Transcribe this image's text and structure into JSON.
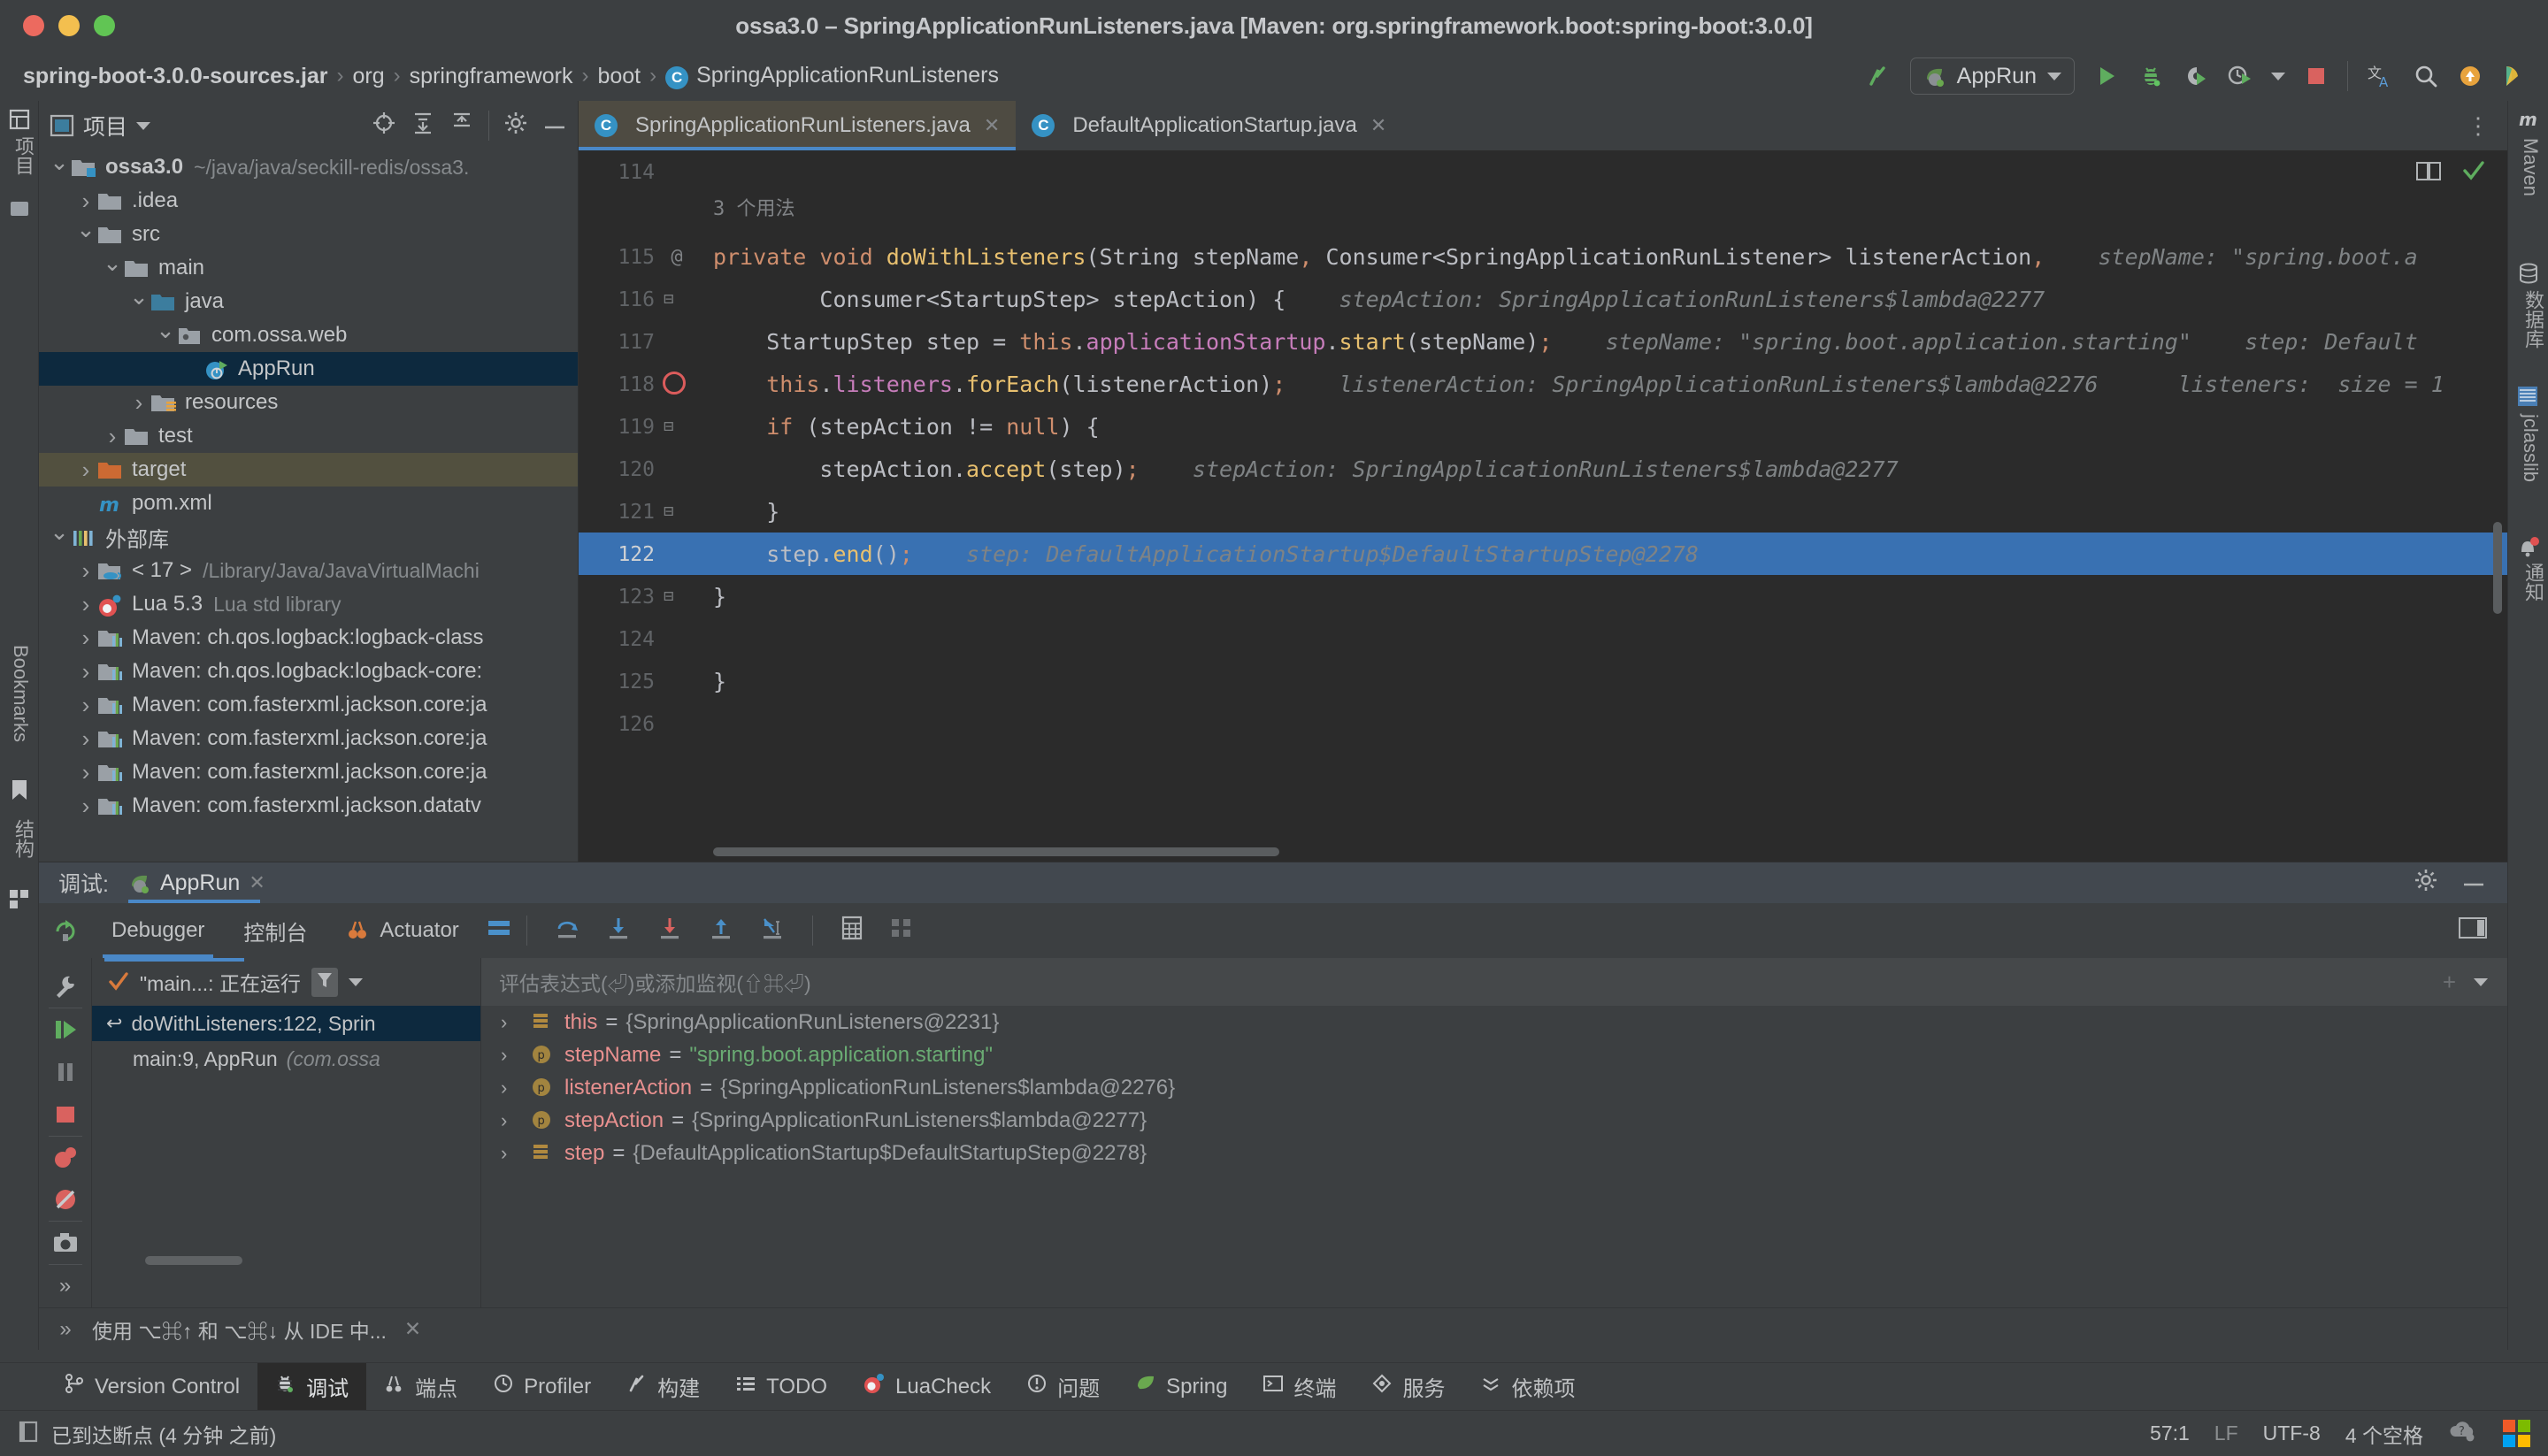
{
  "window": {
    "title": "ossa3.0 – SpringApplicationRunListeners.java [Maven: org.springframework.boot:spring-boot:3.0.0]",
    "traffic": [
      "close-button",
      "minimize-button",
      "maximize-button"
    ]
  },
  "breadcrumb": {
    "items": [
      {
        "label": "spring-boot-3.0.0-sources.jar",
        "kind": "jar"
      },
      {
        "label": "org",
        "kind": "package"
      },
      {
        "label": "springframework",
        "kind": "package"
      },
      {
        "label": "boot",
        "kind": "package"
      },
      {
        "label": "SpringApplicationRunListeners",
        "kind": "class",
        "badge": "C"
      }
    ],
    "separator": "›"
  },
  "nav_right": {
    "run_config": "AppRun",
    "actions": [
      "build-icon",
      "run-button",
      "debug-button",
      "run-with-coverage-button",
      "profiler-button",
      "stop-button",
      "translate-icon",
      "search-everywhere-icon",
      "update-icon",
      "ai-assistant-icon"
    ]
  },
  "project_panel": {
    "title": "项目",
    "header_actions": [
      "select-opened-file-icon",
      "expand-all-icon",
      "collapse-all-icon",
      "settings-gear-icon",
      "hide-icon"
    ],
    "tree": [
      {
        "indent": 0,
        "chev": "open",
        "icon": "module-folder",
        "label": "ossa3.0",
        "sub": "~/java/java/seckill-redis/ossa3.",
        "bold": true
      },
      {
        "indent": 1,
        "chev": "closed",
        "icon": "folder",
        "label": ".idea",
        "sub": ""
      },
      {
        "indent": 1,
        "chev": "open",
        "icon": "folder",
        "label": "src",
        "sub": ""
      },
      {
        "indent": 2,
        "chev": "open",
        "icon": "folder",
        "label": "main",
        "sub": ""
      },
      {
        "indent": 3,
        "chev": "open",
        "icon": "folder-blue",
        "label": "java",
        "sub": ""
      },
      {
        "indent": 4,
        "chev": "open",
        "icon": "package",
        "label": "com.ossa.web",
        "sub": ""
      },
      {
        "indent": 5,
        "chev": "none",
        "icon": "spring-class",
        "label": "AppRun",
        "sub": "",
        "state": "selected"
      },
      {
        "indent": 3,
        "chev": "closed",
        "icon": "folder-res",
        "label": "resources",
        "sub": ""
      },
      {
        "indent": 2,
        "chev": "closed",
        "icon": "folder",
        "label": "test",
        "sub": ""
      },
      {
        "indent": 1,
        "chev": "closed",
        "icon": "folder-orange",
        "label": "target",
        "sub": "",
        "state": "highlighted"
      },
      {
        "indent": 1,
        "chev": "none",
        "icon": "maven-file",
        "label": "pom.xml",
        "sub": ""
      },
      {
        "indent": 0,
        "chev": "open",
        "icon": "library",
        "label": "外部库",
        "sub": ""
      },
      {
        "indent": 1,
        "chev": "closed",
        "icon": "jdk",
        "label": "< 17 >",
        "sub": "/Library/Java/JavaVirtualMachi"
      },
      {
        "indent": 1,
        "chev": "closed",
        "icon": "lua",
        "label": "Lua 5.3",
        "sub": "Lua std library"
      },
      {
        "indent": 1,
        "chev": "closed",
        "icon": "maven-lib",
        "label": "Maven: ch.qos.logback:logback-class",
        "sub": ""
      },
      {
        "indent": 1,
        "chev": "closed",
        "icon": "maven-lib",
        "label": "Maven: ch.qos.logback:logback-core:",
        "sub": ""
      },
      {
        "indent": 1,
        "chev": "closed",
        "icon": "maven-lib",
        "label": "Maven: com.fasterxml.jackson.core:ja",
        "sub": ""
      },
      {
        "indent": 1,
        "chev": "closed",
        "icon": "maven-lib",
        "label": "Maven: com.fasterxml.jackson.core:ja",
        "sub": ""
      },
      {
        "indent": 1,
        "chev": "closed",
        "icon": "maven-lib",
        "label": "Maven: com.fasterxml.jackson.core:ja",
        "sub": ""
      },
      {
        "indent": 1,
        "chev": "closed",
        "icon": "maven-lib",
        "label": "Maven: com.fasterxml.jackson.datatv",
        "sub": ""
      }
    ]
  },
  "left_rail": {
    "top_items": [
      "项目",
      "提交"
    ],
    "bottom_items": [
      "Bookmarks",
      "结构"
    ]
  },
  "right_rail": {
    "items": [
      "Maven",
      "数据库",
      "jclasslib",
      "通知"
    ]
  },
  "editor": {
    "tabs": [
      {
        "label": "SpringApplicationRunListeners.java",
        "active": true,
        "badge": "C"
      },
      {
        "label": "DefaultApplicationStartup.java",
        "active": false,
        "badge": "C"
      }
    ],
    "usage_hint": "3 个用法",
    "lines": [
      {
        "num": "114",
        "gutter": "",
        "fold": "",
        "text": ""
      },
      {
        "num": "115",
        "gutter": "@",
        "fold": "",
        "text": "private void doWithListeners(String stepName, Consumer<SpringApplicationRunListener> listenerAction,",
        "inlay": "stepName: \"spring.boot.a"
      },
      {
        "num": "116",
        "gutter": "",
        "fold": "minus",
        "text": "        Consumer<StartupStep> stepAction) {",
        "inlay": "stepAction: SpringApplicationRunListeners$lambda@2277"
      },
      {
        "num": "117",
        "gutter": "",
        "fold": "",
        "text": "    StartupStep step = this.applicationStartup.start(stepName);",
        "inlay": "stepName: \"spring.boot.application.starting\"    step: Default"
      },
      {
        "num": "118",
        "gutter": "breakpoint",
        "fold": "",
        "text": "    this.listeners.forEach(listenerAction);",
        "inlay": "listenerAction: SpringApplicationRunListeners$lambda@2276      listeners:  size = 1"
      },
      {
        "num": "119",
        "gutter": "",
        "fold": "minus",
        "text": "    if (stepAction != null) {",
        "inlay": ""
      },
      {
        "num": "120",
        "gutter": "",
        "fold": "",
        "text": "        stepAction.accept(step);",
        "inlay": "stepAction: SpringApplicationRunListeners$lambda@2277"
      },
      {
        "num": "121",
        "gutter": "",
        "fold": "minus",
        "text": "    }",
        "inlay": ""
      },
      {
        "num": "122",
        "gutter": "",
        "fold": "",
        "text": "    step.end();",
        "inlay": "step: DefaultApplicationStartup$DefaultStartupStep@2278",
        "highlight": true
      },
      {
        "num": "123",
        "gutter": "",
        "fold": "minus",
        "text": "}",
        "inlay": ""
      },
      {
        "num": "124",
        "gutter": "",
        "fold": "",
        "text": "",
        "inlay": ""
      },
      {
        "num": "125",
        "gutter": "",
        "fold": "",
        "text": "}",
        "inlay": ""
      },
      {
        "num": "126",
        "gutter": "",
        "fold": "",
        "text": "",
        "inlay": ""
      }
    ],
    "inspection_icons": [
      "reader-mode-icon",
      "inspections-ok-icon"
    ]
  },
  "debug": {
    "header_label": "调试:",
    "session_tab": "AppRun",
    "header_actions": [
      "settings-gear-icon",
      "hide-icon"
    ],
    "toolbar_tabs": [
      {
        "label": "Debugger",
        "active": true
      },
      {
        "label": "控制台",
        "active": false
      },
      {
        "label": "Actuator",
        "active": false,
        "icon": "actuator-icon"
      }
    ],
    "toolbar_actions": [
      "layout-icon",
      "step-over-icon",
      "step-into-icon",
      "force-step-into-icon",
      "step-out-icon",
      "run-to-cursor-icon",
      "evaluate-icon",
      "mute-breakpoints-icon"
    ],
    "rail_actions": [
      "rerun-icon",
      "settings-wrench-icon",
      "resume-icon",
      "pause-icon",
      "stop-icon",
      "view-breakpoints-icon",
      "mute-breakpoints-icon",
      "screenshot-icon",
      "more-icon"
    ],
    "thread_selector": "\"main...: 正在运行",
    "frames": [
      {
        "label": "doWithListeners:122, Sprin",
        "sub": "",
        "selected": true
      },
      {
        "label": "main:9, AppRun",
        "sub": "(com.ossa",
        "selected": false
      }
    ],
    "expression_placeholder": "评估表达式(⏎)或添加监视(⇧⌘⏎)",
    "variables": [
      {
        "icon": "field-icon",
        "name": "this",
        "value": "{SpringApplicationRunListeners@2231}",
        "is_string": false
      },
      {
        "icon": "param-icon",
        "name": "stepName",
        "value": "\"spring.boot.application.starting\"",
        "is_string": true
      },
      {
        "icon": "param-icon",
        "name": "listenerAction",
        "value": "{SpringApplicationRunListeners$lambda@2276}",
        "is_string": false
      },
      {
        "icon": "param-icon",
        "name": "stepAction",
        "value": "{SpringApplicationRunListeners$lambda@2277}",
        "is_string": false
      },
      {
        "icon": "field-icon",
        "name": "step",
        "value": "{DefaultApplicationStartup$DefaultStartupStep@2278}",
        "is_string": false
      }
    ],
    "hint": "使用 ⌥⌘↑ 和 ⌥⌘↓ 从 IDE 中...",
    "hint_close": "✕"
  },
  "bottom_bar": {
    "items": [
      {
        "label": "Version Control",
        "icon": "branch-icon",
        "active": false
      },
      {
        "label": "调试",
        "icon": "debug-icon",
        "active": true
      },
      {
        "label": "端点",
        "icon": "endpoints-icon",
        "active": false
      },
      {
        "label": "Profiler",
        "icon": "profiler-icon",
        "active": false
      },
      {
        "label": "构建",
        "icon": "build-icon",
        "active": false
      },
      {
        "label": "TODO",
        "icon": "todo-icon",
        "active": false
      },
      {
        "label": "LuaCheck",
        "icon": "lua-icon",
        "active": false
      },
      {
        "label": "问题",
        "icon": "problems-icon",
        "active": false
      },
      {
        "label": "Spring",
        "icon": "spring-icon",
        "active": false
      },
      {
        "label": "终端",
        "icon": "terminal-icon",
        "active": false
      },
      {
        "label": "服务",
        "icon": "services-icon",
        "active": false
      },
      {
        "label": "依赖项",
        "icon": "dependencies-icon",
        "active": false
      }
    ]
  },
  "status_bar": {
    "message": "已到达断点 (4 分钟 之前)",
    "message_icon": "breakpoint-reached-icon",
    "caret": "57:1",
    "line_separator": "LF",
    "encoding": "UTF-8",
    "indent": "4 个空格",
    "right_icons": [
      "ai-cloud-icon",
      "microsoft-logo-icon"
    ]
  },
  "colors": {
    "accent_blue": "#4a88c7",
    "selection_blue": "#3971b2",
    "editor_bg": "#2b2b2b",
    "panel_bg": "#3c3f41",
    "keyword_orange": "#cf8e6d",
    "method_yellow": "#e8c06f",
    "field_purple": "#c77dbb",
    "string_green": "#6aab73",
    "inlay_gray": "#7f8385"
  }
}
